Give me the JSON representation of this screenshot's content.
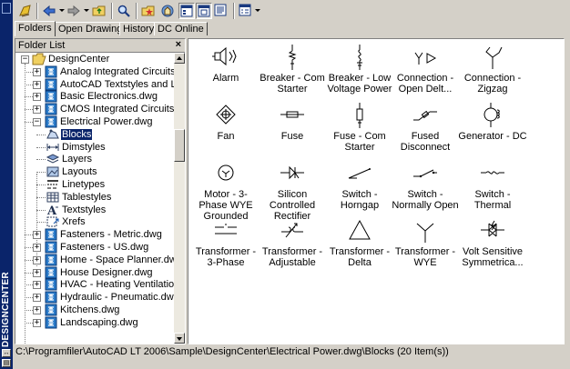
{
  "window": {
    "title": "DESIGNCENTER"
  },
  "tabs": [
    {
      "label": "Folders",
      "active": true
    },
    {
      "label": "Open Drawings",
      "active": false
    },
    {
      "label": "History",
      "active": false
    },
    {
      "label": "DC Online",
      "active": false
    }
  ],
  "folder_list": {
    "header": "Folder List",
    "close": "×",
    "items": [
      {
        "label": "DesignCenter",
        "level": 0,
        "expander": "−",
        "icon": "open-folder-icon"
      },
      {
        "label": "Analog Integrated Circuits.dwg",
        "level": 1,
        "expander": "+",
        "icon": "drawing-icon"
      },
      {
        "label": "AutoCAD Textstyles and Linetyp",
        "level": 1,
        "expander": "+",
        "icon": "drawing-icon"
      },
      {
        "label": "Basic Electronics.dwg",
        "level": 1,
        "expander": "+",
        "icon": "drawing-icon"
      },
      {
        "label": "CMOS Integrated Circuits.dwg",
        "level": 1,
        "expander": "+",
        "icon": "drawing-icon"
      },
      {
        "label": "Electrical Power.dwg",
        "level": 1,
        "expander": "−",
        "icon": "drawing-icon"
      },
      {
        "label": "Blocks",
        "level": 2,
        "icon": "blocks-icon",
        "selected": true
      },
      {
        "label": "Dimstyles",
        "level": 2,
        "icon": "dimstyles-icon"
      },
      {
        "label": "Layers",
        "level": 2,
        "icon": "layers-icon"
      },
      {
        "label": "Layouts",
        "level": 2,
        "icon": "layouts-icon"
      },
      {
        "label": "Linetypes",
        "level": 2,
        "icon": "linetypes-icon"
      },
      {
        "label": "Tablestyles",
        "level": 2,
        "icon": "tablestyles-icon"
      },
      {
        "label": "Textstyles",
        "level": 2,
        "icon": "textstyles-icon"
      },
      {
        "label": "Xrefs",
        "level": 2,
        "icon": "xrefs-icon"
      },
      {
        "label": "Fasteners - Metric.dwg",
        "level": 1,
        "expander": "+",
        "icon": "drawing-icon"
      },
      {
        "label": "Fasteners - US.dwg",
        "level": 1,
        "expander": "+",
        "icon": "drawing-icon"
      },
      {
        "label": "Home - Space Planner.dwg",
        "level": 1,
        "expander": "+",
        "icon": "drawing-icon"
      },
      {
        "label": "House Designer.dwg",
        "level": 1,
        "expander": "+",
        "icon": "drawing-icon"
      },
      {
        "label": "HVAC - Heating Ventilation Air C",
        "level": 1,
        "expander": "+",
        "icon": "drawing-icon"
      },
      {
        "label": "Hydraulic - Pneumatic.dwg",
        "level": 1,
        "expander": "+",
        "icon": "drawing-icon"
      },
      {
        "label": "Kitchens.dwg",
        "level": 1,
        "expander": "+",
        "icon": "drawing-icon"
      },
      {
        "label": "Landscaping.dwg",
        "level": 1,
        "expander": "+",
        "icon": "drawing-icon"
      }
    ]
  },
  "blocks": [
    {
      "label": "Alarm",
      "symbol": "alarm-symbol"
    },
    {
      "label": "Breaker - Com Starter",
      "symbol": "breaker-com-starter-symbol"
    },
    {
      "label": "Breaker - Low Voltage Power",
      "symbol": "breaker-low-voltage-symbol"
    },
    {
      "label": "Connection - Open Delt...",
      "symbol": "connection-open-delta-symbol"
    },
    {
      "label": "Connection - Zigzag",
      "symbol": "connection-zigzag-symbol"
    },
    {
      "label": "Fan",
      "symbol": "fan-symbol"
    },
    {
      "label": "Fuse",
      "symbol": "fuse-symbol"
    },
    {
      "label": "Fuse - Com Starter",
      "symbol": "fuse-com-starter-symbol"
    },
    {
      "label": "Fused Disconnect",
      "symbol": "fused-disconnect-symbol"
    },
    {
      "label": "Generator - DC",
      "symbol": "generator-dc-symbol"
    },
    {
      "label": "Motor - 3-Phase WYE Grounded",
      "symbol": "motor-3phase-symbol"
    },
    {
      "label": "Silicon Controlled Rectifier",
      "symbol": "scr-symbol"
    },
    {
      "label": "Switch - Horngap",
      "symbol": "switch-horngap-symbol"
    },
    {
      "label": "Switch - Normally Open",
      "symbol": "switch-normally-open-symbol"
    },
    {
      "label": "Switch - Thermal",
      "symbol": "switch-thermal-symbol"
    },
    {
      "label": "Transformer - 3-Phase",
      "symbol": "transformer-3phase-symbol"
    },
    {
      "label": "Transformer - Adjustable",
      "symbol": "transformer-adjustable-symbol"
    },
    {
      "label": "Transformer - Delta",
      "symbol": "transformer-delta-symbol"
    },
    {
      "label": "Transformer - WYE",
      "symbol": "transformer-wye-symbol"
    },
    {
      "label": "Volt Sensitive Symmetrica...",
      "symbol": "volt-sensitive-symbol"
    }
  ],
  "status_bar": {
    "path": "C:\\Programfiler\\AutoCAD LT 2006\\Sample\\DesignCenter\\Electrical Power.dwg\\Blocks (20 Item(s))"
  },
  "colors": {
    "title_strip": "#0a246a",
    "selection": "#0a246a",
    "chrome": "#d4d0c8"
  }
}
